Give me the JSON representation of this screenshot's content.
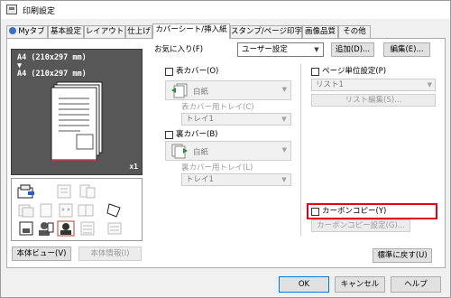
{
  "window": {
    "title": "印刷設定"
  },
  "tabs": [
    {
      "label": "Myタブ"
    },
    {
      "label": "基本設定"
    },
    {
      "label": "レイアウト"
    },
    {
      "label": "仕上げ"
    },
    {
      "label": "カバーシート/挿入紙",
      "active": true
    },
    {
      "label": "スタンプ/ページ印字"
    },
    {
      "label": "画像品質"
    },
    {
      "label": "その他"
    }
  ],
  "favorites": {
    "label": "お気に入り(F)",
    "value": "ユーザー設定",
    "add_label": "追加(D)...",
    "edit_label": "編集(E)..."
  },
  "preview": {
    "paper_size_1": "A4 (210x297 mm)",
    "arrow": "▼",
    "paper_size_2": "A4 (210x297 mm)",
    "copies": "x1"
  },
  "left_buttons": {
    "view_label": "本体ビュー(V)",
    "info_label": "本体情報(I)"
  },
  "front_cover": {
    "checkbox_label": "表カバー(O)",
    "paper_value": "白紙",
    "tray_label": "表カバー用トレイ(C)",
    "tray_value": "トレイ1"
  },
  "back_cover": {
    "checkbox_label": "裏カバー(B)",
    "paper_value": "白紙",
    "tray_label": "裏カバー用トレイ(L)",
    "tray_value": "トレイ1"
  },
  "per_page": {
    "checkbox_label": "ページ単位設定(P)",
    "list_value": "リスト1",
    "edit_list_label": "リスト編集(S)..."
  },
  "carbon_copy": {
    "checkbox_label": "カーボンコピー(Y)",
    "settings_label": "カーボンコピー設定(G)..."
  },
  "reset_label": "標準に戻す(U)",
  "footer": {
    "ok_label": "OK",
    "cancel_label": "キャンセル",
    "help_label": "ヘルプ"
  },
  "colors": {
    "highlight": "#e0001a",
    "preview_bg": "#575757",
    "panel_bg": "#ffffff",
    "window_bg": "#f0f0f0"
  }
}
